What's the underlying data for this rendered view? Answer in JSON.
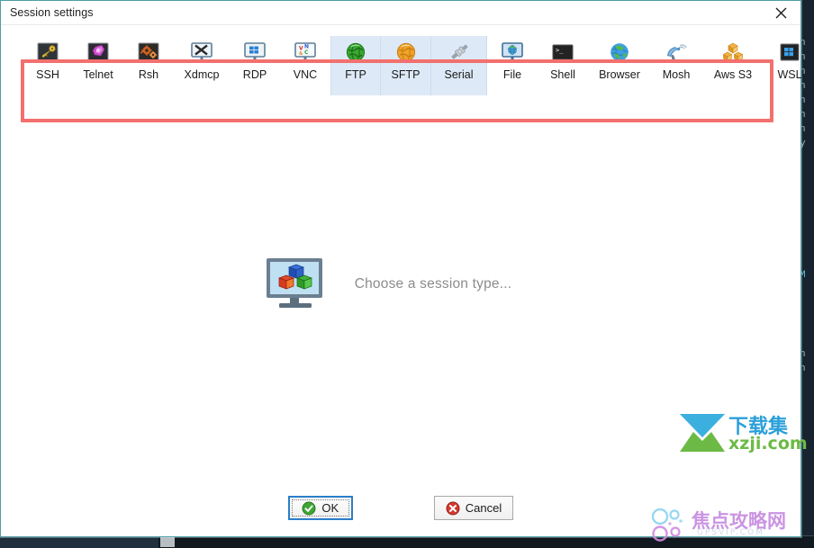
{
  "window": {
    "title": "Session settings",
    "close_icon": "close-icon"
  },
  "session_types": [
    {
      "label": "SSH",
      "icon": "ssh-key-icon",
      "highlighted": false
    },
    {
      "label": "Telnet",
      "icon": "telnet-icon",
      "highlighted": false
    },
    {
      "label": "Rsh",
      "icon": "rsh-gears-icon",
      "highlighted": false
    },
    {
      "label": "Xdmcp",
      "icon": "xdmcp-monitor-icon",
      "highlighted": false
    },
    {
      "label": "RDP",
      "icon": "rdp-monitor-icon",
      "highlighted": false
    },
    {
      "label": "VNC",
      "icon": "vnc-monitor-icon",
      "highlighted": false
    },
    {
      "label": "FTP",
      "icon": "ftp-green-globe-icon",
      "highlighted": true
    },
    {
      "label": "SFTP",
      "icon": "sftp-orange-globe-icon",
      "highlighted": true
    },
    {
      "label": "Serial",
      "icon": "serial-plug-icon",
      "highlighted": true
    },
    {
      "label": "File",
      "icon": "file-monitor-globe-icon",
      "highlighted": false
    },
    {
      "label": "Shell",
      "icon": "shell-terminal-icon",
      "highlighted": false
    },
    {
      "label": "Browser",
      "icon": "browser-globe-icon",
      "highlighted": false
    },
    {
      "label": "Mosh",
      "icon": "mosh-satellite-icon",
      "highlighted": false
    },
    {
      "label": "Aws S3",
      "icon": "aws-s3-cubes-icon",
      "highlighted": false
    },
    {
      "label": "WSL",
      "icon": "wsl-windows-icon",
      "highlighted": false
    }
  ],
  "main": {
    "placeholder_text": "Choose a session type...",
    "placeholder_icon": "monitor-cubes-icon"
  },
  "annotation": {
    "highlight_color": "#f2706d",
    "type": "red-rectangle-callout"
  },
  "buttons": {
    "ok": {
      "label": "OK",
      "icon": "green-check-icon",
      "focused": true
    },
    "cancel": {
      "label": "Cancel",
      "icon": "red-x-icon",
      "focused": false
    }
  },
  "colors": {
    "dialog_border": "#4c9ea8",
    "highlight_cell_bg": "#dde9f6",
    "focus_border": "#2a7fc9",
    "placeholder_text": "#8c8c8c",
    "terminal_bg": "#17242f"
  },
  "watermarks": [
    {
      "cn": "下载集",
      "en": "xzji.com",
      "logo": "arrow-logo-icon"
    },
    {
      "cn": "焦点攻略网",
      "en": "GPSVIP.COM",
      "logo": "circles-logo-icon"
    }
  ],
  "background_terminal": {
    "visible_chars": [
      "n",
      "n",
      "n",
      "n",
      "n",
      "n",
      "n",
      "y",
      "M",
      "n",
      "n"
    ]
  }
}
